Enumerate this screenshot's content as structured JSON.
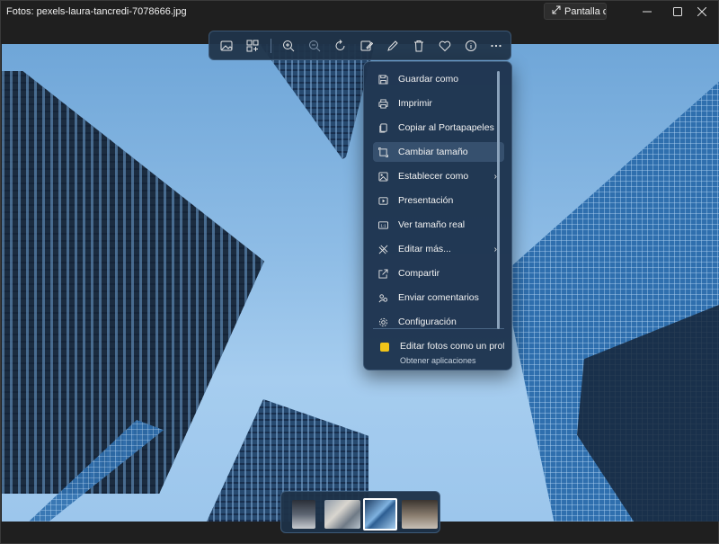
{
  "window": {
    "title": "Fotos: pexels-laura-tancredi-7078666.jpg",
    "fullscreen_label": "Pantalla co",
    "controls": [
      "minimize",
      "maximize",
      "close"
    ]
  },
  "toolbar": {
    "buttons": [
      {
        "name": "image-icon"
      },
      {
        "name": "collection-icon"
      },
      {
        "name": "zoom-in-icon"
      },
      {
        "name": "zoom-out-icon"
      },
      {
        "name": "rotate-icon"
      },
      {
        "name": "edit-image-icon"
      },
      {
        "name": "draw-icon"
      },
      {
        "name": "delete-icon"
      },
      {
        "name": "favorite-icon"
      },
      {
        "name": "info-icon"
      },
      {
        "name": "more-icon"
      }
    ]
  },
  "menu": {
    "items": [
      {
        "label": "Guardar como",
        "icon": "save-icon"
      },
      {
        "label": "Imprimir",
        "icon": "print-icon"
      },
      {
        "label": "Copiar al Portapapeles",
        "icon": "copy-icon"
      },
      {
        "label": "Cambiar tamaño",
        "icon": "resize-icon",
        "active": true
      },
      {
        "label": "Establecer como",
        "icon": "set-as-icon",
        "submenu": true
      },
      {
        "label": "Presentación",
        "icon": "slideshow-icon"
      },
      {
        "label": "Ver tamaño real",
        "icon": "actual-size-icon"
      },
      {
        "label": "Editar más...",
        "icon": "edit-more-icon",
        "submenu": true
      },
      {
        "label": "Compartir",
        "icon": "share-icon"
      },
      {
        "label": "Enviar comentarios",
        "icon": "feedback-icon"
      },
      {
        "label": "Configuración",
        "icon": "settings-icon"
      }
    ],
    "promo": {
      "title": "Editar fotos como un profe",
      "subtitle": "Obtener aplicaciones"
    }
  },
  "filmstrip": {
    "thumbnails": [
      "office-interior",
      "street-scene",
      "skyscrapers-current",
      "room-interior"
    ],
    "selected_index": 2
  },
  "colors": {
    "accent": "#ffffff",
    "menu_bg": "#1e344e",
    "toolbar_bg": "#20344a"
  }
}
